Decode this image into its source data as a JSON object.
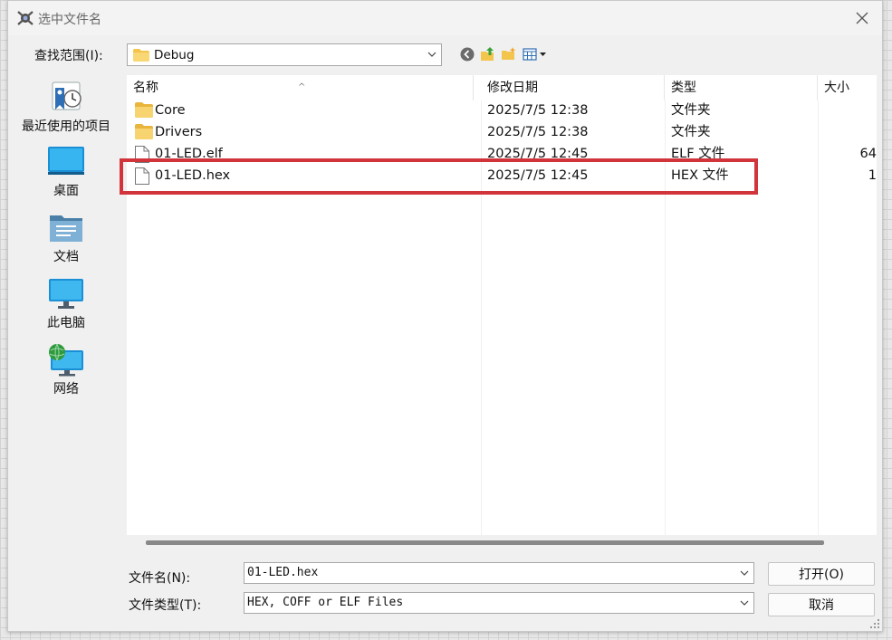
{
  "window": {
    "title": "选中文件名"
  },
  "lookin": {
    "label": "查找范围(I):",
    "value": "Debug"
  },
  "places": [
    {
      "label": "最近使用的项目",
      "icon": "recent-places-icon"
    },
    {
      "label": "桌面",
      "icon": "desktop-icon"
    },
    {
      "label": "文档",
      "icon": "documents-icon"
    },
    {
      "label": "此电脑",
      "icon": "this-pc-icon"
    },
    {
      "label": "网络",
      "icon": "network-icon"
    }
  ],
  "columns": {
    "name": "名称",
    "date": "修改日期",
    "type": "类型",
    "size": "大小"
  },
  "files": [
    {
      "name": "Core",
      "date": "2025/7/5 12:38",
      "type": "文件夹",
      "size": "",
      "icon": "folder-icon"
    },
    {
      "name": "Drivers",
      "date": "2025/7/5 12:38",
      "type": "文件夹",
      "size": "",
      "icon": "folder-icon"
    },
    {
      "name": "01-LED.elf",
      "date": "2025/7/5 12:45",
      "type": "ELF 文件",
      "size": "64",
      "icon": "file-icon"
    },
    {
      "name": "01-LED.hex",
      "date": "2025/7/5 12:45",
      "type": "HEX 文件",
      "size": "1",
      "icon": "file-icon"
    }
  ],
  "filename": {
    "label": "文件名(N):",
    "value": "01-LED.hex"
  },
  "filetype": {
    "label": "文件类型(T):",
    "value": "HEX, COFF or ELF Files"
  },
  "buttons": {
    "open": "打开(O)",
    "cancel": "取消"
  },
  "colors": {
    "highlight": "#d1343a",
    "folder": "#f3c54d",
    "dialog_bg": "#f0f0f0"
  }
}
